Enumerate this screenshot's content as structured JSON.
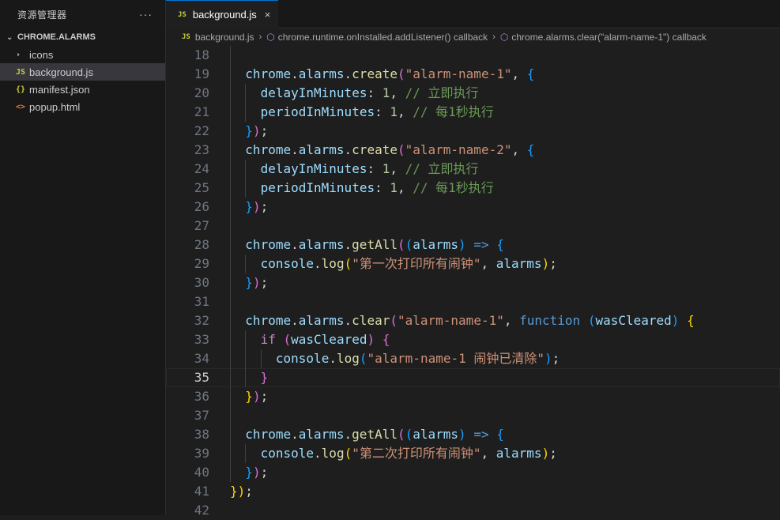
{
  "sidebar": {
    "title": "资源管理器",
    "more": "···",
    "folder": "CHROME.ALARMS",
    "items": [
      {
        "icon": "chevron-right-icon",
        "glyph": "›",
        "label": "icons"
      },
      {
        "icon": "js-file-icon",
        "glyph": "JS",
        "label": "background.js"
      },
      {
        "icon": "json-file-icon",
        "glyph": "{}",
        "label": "manifest.json"
      },
      {
        "icon": "html-file-icon",
        "glyph": "<>",
        "label": "popup.html"
      }
    ]
  },
  "tab": {
    "icon": "JS",
    "label": "background.js",
    "close": "×"
  },
  "breadcrumb": {
    "file": "background.js",
    "items": [
      "chrome.runtime.onInstalled.addListener() callback",
      "chrome.alarms.clear(\"alarm-name-1\") callback"
    ]
  },
  "editor": {
    "current_line": 35,
    "lines": [
      {
        "n": 18,
        "indent": 0,
        "tokens": []
      },
      {
        "n": 19,
        "indent": 1,
        "tokens": [
          [
            "var",
            "chrome"
          ],
          [
            "p",
            "."
          ],
          [
            "var",
            "alarms"
          ],
          [
            "p",
            "."
          ],
          [
            "fn",
            "create"
          ],
          [
            "b2",
            "("
          ],
          [
            "str",
            "\"alarm-name-1\""
          ],
          [
            "p",
            ", "
          ],
          [
            "b3",
            "{"
          ]
        ]
      },
      {
        "n": 20,
        "indent": 2,
        "tokens": [
          [
            "var",
            "delayInMinutes"
          ],
          [
            "p",
            ": "
          ],
          [
            "num",
            "1"
          ],
          [
            "p",
            ", "
          ],
          [
            "com",
            "// 立即执行"
          ]
        ]
      },
      {
        "n": 21,
        "indent": 2,
        "tokens": [
          [
            "var",
            "periodInMinutes"
          ],
          [
            "p",
            ": "
          ],
          [
            "num",
            "1"
          ],
          [
            "p",
            ", "
          ],
          [
            "com",
            "// 每1秒执行"
          ]
        ]
      },
      {
        "n": 22,
        "indent": 1,
        "tokens": [
          [
            "b3",
            "}"
          ],
          [
            "b2",
            ")"
          ],
          [
            "p",
            ";"
          ]
        ]
      },
      {
        "n": 23,
        "indent": 1,
        "tokens": [
          [
            "var",
            "chrome"
          ],
          [
            "p",
            "."
          ],
          [
            "var",
            "alarms"
          ],
          [
            "p",
            "."
          ],
          [
            "fn",
            "create"
          ],
          [
            "b2",
            "("
          ],
          [
            "str",
            "\"alarm-name-2\""
          ],
          [
            "p",
            ", "
          ],
          [
            "b3",
            "{"
          ]
        ]
      },
      {
        "n": 24,
        "indent": 2,
        "tokens": [
          [
            "var",
            "delayInMinutes"
          ],
          [
            "p",
            ": "
          ],
          [
            "num",
            "1"
          ],
          [
            "p",
            ", "
          ],
          [
            "com",
            "// 立即执行"
          ]
        ]
      },
      {
        "n": 25,
        "indent": 2,
        "tokens": [
          [
            "var",
            "periodInMinutes"
          ],
          [
            "p",
            ": "
          ],
          [
            "num",
            "1"
          ],
          [
            "p",
            ", "
          ],
          [
            "com",
            "// 每1秒执行"
          ]
        ]
      },
      {
        "n": 26,
        "indent": 1,
        "tokens": [
          [
            "b3",
            "}"
          ],
          [
            "b2",
            ")"
          ],
          [
            "p",
            ";"
          ]
        ]
      },
      {
        "n": 27,
        "indent": 0,
        "tokens": []
      },
      {
        "n": 28,
        "indent": 1,
        "tokens": [
          [
            "var",
            "chrome"
          ],
          [
            "p",
            "."
          ],
          [
            "var",
            "alarms"
          ],
          [
            "p",
            "."
          ],
          [
            "fn",
            "getAll"
          ],
          [
            "b2",
            "("
          ],
          [
            "b3",
            "("
          ],
          [
            "var",
            "alarms"
          ],
          [
            "b3",
            ")"
          ],
          [
            "p",
            " "
          ],
          [
            "kw",
            "=>"
          ],
          [
            "p",
            " "
          ],
          [
            "b3",
            "{"
          ]
        ]
      },
      {
        "n": 29,
        "indent": 2,
        "tokens": [
          [
            "var",
            "console"
          ],
          [
            "p",
            "."
          ],
          [
            "fn",
            "log"
          ],
          [
            "b1",
            "("
          ],
          [
            "str",
            "\"第一次打印所有闹钟\""
          ],
          [
            "p",
            ", "
          ],
          [
            "var",
            "alarms"
          ],
          [
            "b1",
            ")"
          ],
          [
            "p",
            ";"
          ]
        ]
      },
      {
        "n": 30,
        "indent": 1,
        "tokens": [
          [
            "b3",
            "}"
          ],
          [
            "b2",
            ")"
          ],
          [
            "p",
            ";"
          ]
        ]
      },
      {
        "n": 31,
        "indent": 0,
        "tokens": []
      },
      {
        "n": 32,
        "indent": 1,
        "tokens": [
          [
            "var",
            "chrome"
          ],
          [
            "p",
            "."
          ],
          [
            "var",
            "alarms"
          ],
          [
            "p",
            "."
          ],
          [
            "fn",
            "clear"
          ],
          [
            "b2",
            "("
          ],
          [
            "str",
            "\"alarm-name-1\""
          ],
          [
            "p",
            ", "
          ],
          [
            "kw",
            "function"
          ],
          [
            "p",
            " "
          ],
          [
            "b3",
            "("
          ],
          [
            "var",
            "wasCleared"
          ],
          [
            "b3",
            ")"
          ],
          [
            "p",
            " "
          ],
          [
            "b1",
            "{"
          ]
        ]
      },
      {
        "n": 33,
        "indent": 2,
        "tokens": [
          [
            "ctl",
            "if"
          ],
          [
            "p",
            " "
          ],
          [
            "b2",
            "("
          ],
          [
            "var",
            "wasCleared"
          ],
          [
            "b2",
            ")"
          ],
          [
            "p",
            " "
          ],
          [
            "b2",
            "{"
          ]
        ]
      },
      {
        "n": 34,
        "indent": 3,
        "tokens": [
          [
            "var",
            "console"
          ],
          [
            "p",
            "."
          ],
          [
            "fn",
            "log"
          ],
          [
            "b3",
            "("
          ],
          [
            "str",
            "\"alarm-name-1 闹钟已清除\""
          ],
          [
            "b3",
            ")"
          ],
          [
            "p",
            ";"
          ]
        ]
      },
      {
        "n": 35,
        "indent": 2,
        "tokens": [
          [
            "b2",
            "}"
          ]
        ]
      },
      {
        "n": 36,
        "indent": 1,
        "tokens": [
          [
            "b1",
            "}"
          ],
          [
            "b2",
            ")"
          ],
          [
            "p",
            ";"
          ]
        ]
      },
      {
        "n": 37,
        "indent": 0,
        "tokens": []
      },
      {
        "n": 38,
        "indent": 1,
        "tokens": [
          [
            "var",
            "chrome"
          ],
          [
            "p",
            "."
          ],
          [
            "var",
            "alarms"
          ],
          [
            "p",
            "."
          ],
          [
            "fn",
            "getAll"
          ],
          [
            "b2",
            "("
          ],
          [
            "b3",
            "("
          ],
          [
            "var",
            "alarms"
          ],
          [
            "b3",
            ")"
          ],
          [
            "p",
            " "
          ],
          [
            "kw",
            "=>"
          ],
          [
            "p",
            " "
          ],
          [
            "b3",
            "{"
          ]
        ]
      },
      {
        "n": 39,
        "indent": 2,
        "tokens": [
          [
            "var",
            "console"
          ],
          [
            "p",
            "."
          ],
          [
            "fn",
            "log"
          ],
          [
            "b1",
            "("
          ],
          [
            "str",
            "\"第二次打印所有闹钟\""
          ],
          [
            "p",
            ", "
          ],
          [
            "var",
            "alarms"
          ],
          [
            "b1",
            ")"
          ],
          [
            "p",
            ";"
          ]
        ]
      },
      {
        "n": 40,
        "indent": 1,
        "tokens": [
          [
            "b3",
            "}"
          ],
          [
            "b2",
            ")"
          ],
          [
            "p",
            ";"
          ]
        ]
      },
      {
        "n": 41,
        "indent": 0,
        "tokens": [
          [
            "b1",
            "}"
          ],
          [
            "b1",
            ")"
          ],
          [
            "p",
            ";"
          ]
        ]
      },
      {
        "n": 42,
        "indent": 0,
        "tokens": []
      }
    ]
  },
  "colors": {
    "background": "#1e1e1e",
    "sidebar": "#181818",
    "accent": "#0078d4",
    "js_icon": "#cbcb41",
    "html_icon": "#e37933"
  }
}
